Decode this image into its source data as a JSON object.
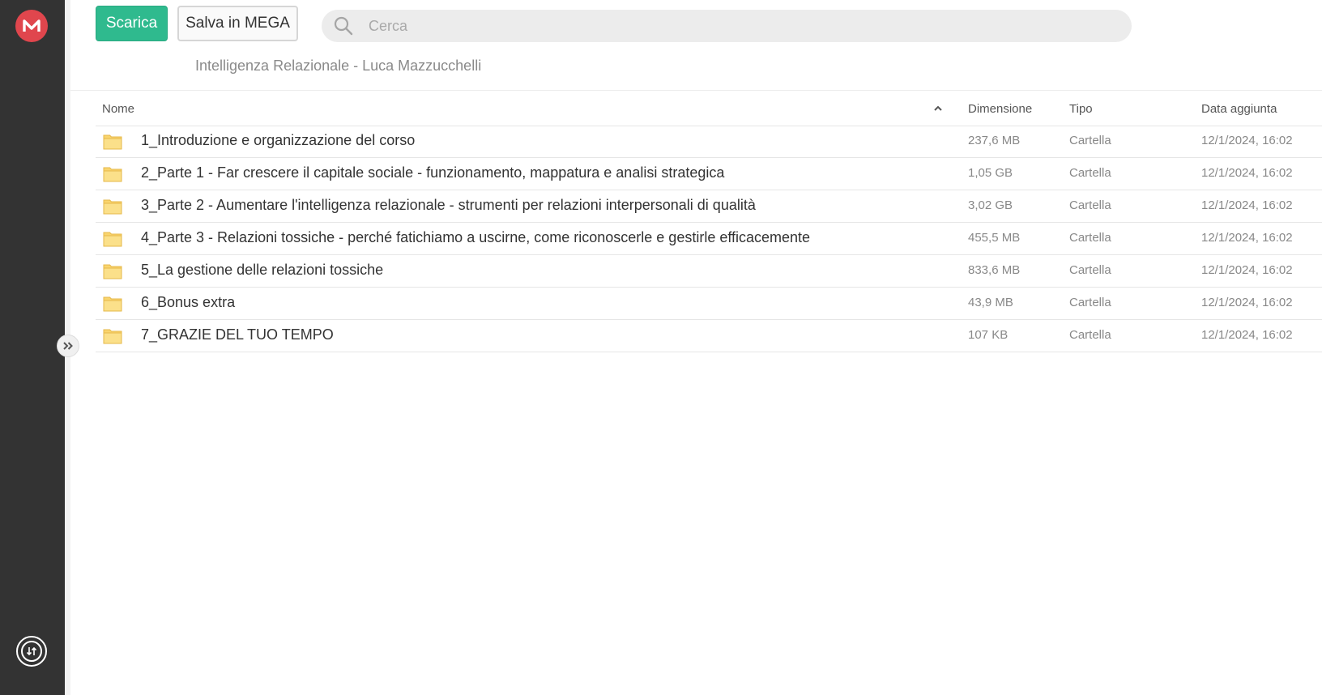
{
  "toolbar": {
    "download_label": "Scarica",
    "save_label": "Salva in MEGA",
    "search_placeholder": "Cerca"
  },
  "breadcrumb": "Intelligenza Relazionale - Luca Mazzucchelli",
  "table": {
    "columns": {
      "name": "Nome",
      "size": "Dimensione",
      "type": "Tipo",
      "date": "Data aggiunta"
    },
    "sort": "name-ascending",
    "rows": [
      {
        "name": "1_Introduzione e organizzazione del corso",
        "size": "237,6 MB",
        "type": "Cartella",
        "date": "12/1/2024, 16:02"
      },
      {
        "name": "2_Parte 1 - Far crescere il capitale sociale - funzionamento, mappatura e analisi strategica",
        "size": "1,05 GB",
        "type": "Cartella",
        "date": "12/1/2024, 16:02"
      },
      {
        "name": "3_Parte 2 - Aumentare l'intelligenza relazionale - strumenti per relazioni interpersonali di qualità",
        "size": "3,02 GB",
        "type": "Cartella",
        "date": "12/1/2024, 16:02"
      },
      {
        "name": "4_Parte 3 - Relazioni tossiche - perché fatichiamo a uscirne, come riconoscerle e gestirle efficacemente",
        "size": "455,5 MB",
        "type": "Cartella",
        "date": "12/1/2024, 16:02"
      },
      {
        "name": "5_La gestione delle relazioni tossiche",
        "size": "833,6 MB",
        "type": "Cartella",
        "date": "12/1/2024, 16:02"
      },
      {
        "name": "6_Bonus extra",
        "size": "43,9 MB",
        "type": "Cartella",
        "date": "12/1/2024, 16:02"
      },
      {
        "name": "7_GRAZIE DEL TUO TEMPO",
        "size": "107 KB",
        "type": "Cartella",
        "date": "12/1/2024, 16:02"
      }
    ]
  },
  "icons": {
    "logo": "mega-logo-icon",
    "transfers": "transfer-manager-icon",
    "expand": "double-chevron-right-icon",
    "search": "search-icon",
    "sort": "chevron-up-icon",
    "folder": "folder-icon"
  },
  "colors": {
    "sidebar": "#333333",
    "brand_red": "#e0464d",
    "download_green": "#2fba8e",
    "folder_yellow": "#f9d56e"
  }
}
